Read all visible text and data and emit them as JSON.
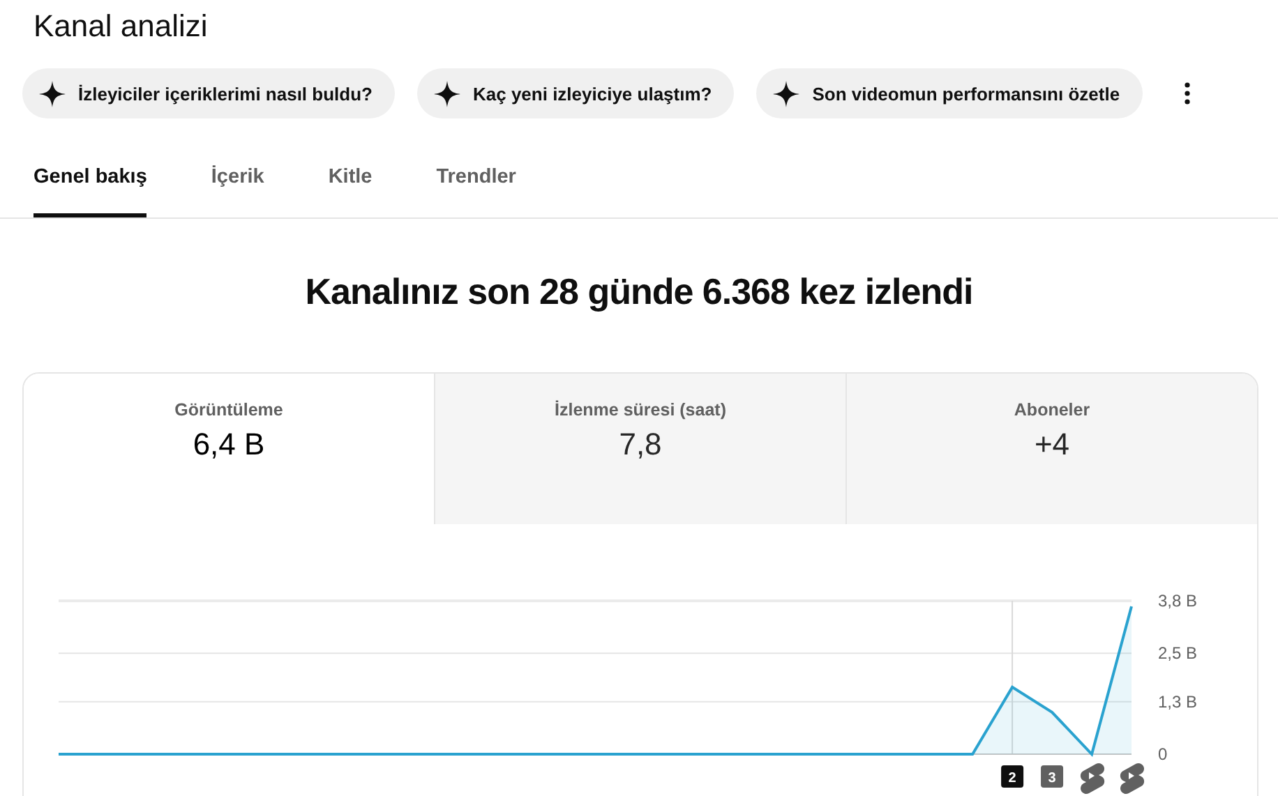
{
  "title": "Kanal analizi",
  "suggestions": [
    {
      "label": "İzleyiciler içeriklerimi nasıl buldu?"
    },
    {
      "label": "Kaç yeni izleyiciye ulaştım?"
    },
    {
      "label": "Son videomun performansını özetle"
    }
  ],
  "tabs": [
    {
      "label": "Genel bakış",
      "selected": true
    },
    {
      "label": "İçerik",
      "selected": false
    },
    {
      "label": "Kitle",
      "selected": false
    },
    {
      "label": "Trendler",
      "selected": false
    }
  ],
  "headline": "Kanalınız son 28 günde 6.368 kez izlendi",
  "metrics": [
    {
      "label": "Görüntüleme",
      "value": "6,4 B",
      "selected": true
    },
    {
      "label": "İzlenme süresi (saat)",
      "value": "7,8",
      "selected": false
    },
    {
      "label": "Aboneler",
      "value": "+4",
      "selected": false
    }
  ],
  "chart": {
    "chart_data": {
      "type": "area",
      "ylim": [
        0,
        3.8
      ],
      "yticks": [
        {
          "value": 0,
          "label": "0"
        },
        {
          "value": 1.3,
          "label": "1,3 B"
        },
        {
          "value": 2.5,
          "label": "2,5 B"
        },
        {
          "value": 3.8,
          "label": "3,8 B"
        }
      ],
      "series": [
        {
          "color": "#2aa2cf",
          "values": [
            0,
            0,
            0,
            0,
            0,
            0,
            0,
            0,
            0,
            0,
            0,
            0,
            0,
            0,
            0,
            0,
            0,
            0,
            0,
            0,
            0,
            0,
            0,
            0,
            1.66,
            1.04,
            0,
            3.66
          ]
        }
      ]
    },
    "markers": [
      {
        "kind": "number",
        "label": "2",
        "highlighted": true
      },
      {
        "kind": "number",
        "label": "3",
        "highlighted": false
      },
      {
        "kind": "short"
      },
      {
        "kind": "short"
      }
    ]
  }
}
